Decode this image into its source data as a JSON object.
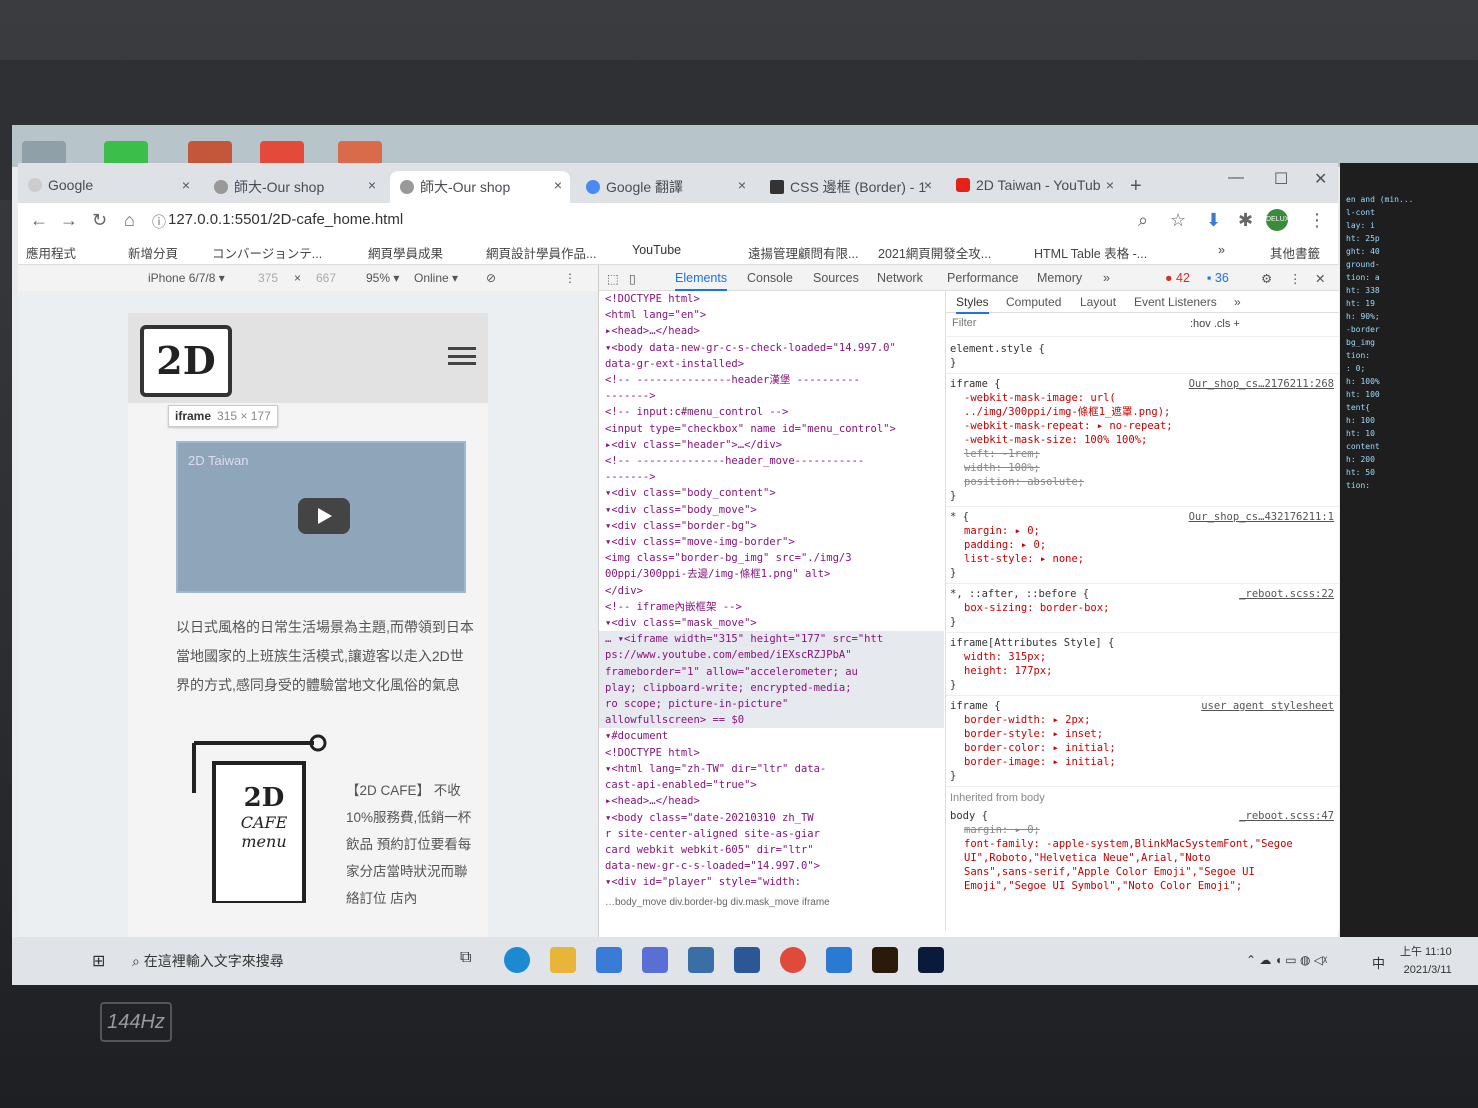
{
  "colors": {
    "accent": "#1a73e8",
    "youtube_red": "#e62117",
    "devtools_tag": "#881280",
    "selected_row": "#e6e9ee"
  },
  "browser": {
    "tabs": [
      {
        "label": "Google",
        "icon": "google-icon",
        "active": false
      },
      {
        "label": "師大-Our shop",
        "icon": "globe-icon",
        "active": false
      },
      {
        "label": "師大-Our shop",
        "icon": "globe-icon",
        "active": true
      },
      {
        "label": "Google 翻譯",
        "icon": "translate-icon",
        "active": false
      },
      {
        "label": "CSS 邊框 (Border) - 1",
        "icon": "site-icon",
        "active": false
      },
      {
        "label": "2D Taiwan - YouTub",
        "icon": "youtube-icon",
        "active": false
      }
    ],
    "new_tab": "+",
    "url": "127.0.0.1:5501/2D-cafe_home.html",
    "profile_badge": "DELUX",
    "bookmarks": [
      "應用程式",
      "新增分頁",
      "コンバージョンテ...",
      "網頁學員成果",
      "網頁設計學員作品...",
      "YouTube",
      "遠揚管理顧問有限...",
      "2021網頁開發全攻...",
      "HTML Table 表格 -...",
      "»",
      "其他書籤"
    ]
  },
  "device_toolbar": {
    "device": "iPhone 6/7/8 ▾",
    "width": "375",
    "times": "×",
    "height": "667",
    "zoom": "95% ▾",
    "network": "Online ▾"
  },
  "page": {
    "logo": "2D",
    "iframe_tip": {
      "tag": "iframe",
      "size": "315 × 177"
    },
    "video_channel": "2D Taiwan",
    "paragraph": "以日式風格的日常生活場景為主題,而帶領到日本當地國家的上班族生活模式,讓遊客以走入2D世界的方式,感同身受的體驗當地文化風俗的氣息",
    "menu_sign": [
      "2D",
      "CAFE",
      "menu"
    ],
    "cafe_text": "【2D CAFE】 不收10%服務費,低銷一杯飲品 預約訂位要看每家分店當時狀況而聯絡訂位 店內"
  },
  "devtools": {
    "tabs": [
      "Elements",
      "Console",
      "Sources",
      "Network",
      "Performance",
      "Memory",
      "»"
    ],
    "errors": "42",
    "warnings": "36",
    "elements": [
      "<!DOCTYPE html>",
      "<html lang=\"en\">",
      "▸<head>…</head>",
      "▾<body data-new-gr-c-s-check-loaded=\"14.997.0\"",
      "data-gr-ext-installed>",
      "  <!-- ---------------header漢堡 ----------",
      "  ------->",
      "  <!-- input:c#menu_control -->",
      "  <input type=\"checkbox\" name id=\"menu_control\">",
      "  ▸<div class=\"header\">…</div>",
      "  <!-- --------------header_move-----------",
      "  ------->",
      "  ▾<div class=\"body_content\">",
      "    ▾<div class=\"body_move\">",
      "      ▾<div class=\"border-bg\">",
      "        ▾<div class=\"move-img-border\">",
      "          <img class=\"border-bg_img\" src=\"./img/3",
      "          00ppi/300ppi-去邊/img-條框1.png\" alt>",
      "        </div>",
      "        <!-- iframe內嵌框架 -->",
      "        ▾<div class=\"mask_move\">",
      "… ▾<iframe width=\"315\" height=\"177\" src=\"htt",
      "          ps://www.youtube.com/embed/iEXscRZJPbA\"",
      "          frameborder=\"1\" allow=\"accelerometer; au",
      "          play; clipboard-write; encrypted-media;",
      "          ro scope; picture-in-picture\"",
      "          allowfullscreen> == $0",
      "            ▾#document",
      "              <!DOCTYPE html>",
      "              ▾<html lang=\"zh-TW\" dir=\"ltr\" data-",
      "              cast-api-enabled=\"true\">",
      "                ▸<head>…</head>",
      "                ▾<body class=\"date-20210310 zh_TW",
      "                r  site-center-aligned site-as-giar",
      "                card webkit webkit-605\" dir=\"ltr\"",
      "                data-new-gr-c-s-loaded=\"14.997.0\">",
      "                  ▾<div id=\"player\" style=\"width:"
    ],
    "breadcrumb": "…body_move   div.border-bg   div.mask_move   iframe",
    "styles_tabs": [
      "Styles",
      "Computed",
      "Layout",
      "Event Listeners",
      "»"
    ],
    "filter_placeholder": "Filter",
    "filter_tools": ":hov  .cls  +",
    "rules": [
      {
        "selector": "element.style {",
        "source": "",
        "props": [],
        "close": "}"
      },
      {
        "selector": "iframe {",
        "source": "Our_shop_cs…2176211:268",
        "props": [
          {
            "text": "-webkit-mask-image: url(",
            "strike": false
          },
          {
            "text": "  ../img/300ppi/img-條框1_遮罩.png);",
            "strike": false
          },
          {
            "text": "-webkit-mask-repeat: ▸ no-repeat;",
            "strike": false
          },
          {
            "text": "-webkit-mask-size: 100% 100%;",
            "strike": false
          },
          {
            "text": "left: -1rem;",
            "strike": true
          },
          {
            "text": "width: 100%;",
            "strike": true
          },
          {
            "text": "position: absolute;",
            "strike": true
          }
        ],
        "close": "}"
      },
      {
        "selector": "* {",
        "source": "Our_shop_cs…432176211:1",
        "props": [
          {
            "text": "margin: ▸ 0;",
            "strike": false
          },
          {
            "text": "padding: ▸ 0;",
            "strike": false
          },
          {
            "text": "list-style: ▸ none;",
            "strike": false
          }
        ],
        "close": "}"
      },
      {
        "selector": "*, ::after, ::before {",
        "source": "_reboot.scss:22",
        "props": [
          {
            "text": "box-sizing: border-box;",
            "strike": false
          }
        ],
        "close": "}"
      },
      {
        "selector": "iframe[Attributes Style] {",
        "source": "",
        "props": [
          {
            "text": "width: 315px;",
            "strike": false
          },
          {
            "text": "height: 177px;",
            "strike": false
          }
        ],
        "close": "}"
      },
      {
        "selector": "iframe {",
        "source": "user agent stylesheet",
        "props": [
          {
            "text": "border-width: ▸ 2px;",
            "strike": false
          },
          {
            "text": "border-style: ▸ inset;",
            "strike": false
          },
          {
            "text": "border-color: ▸ initial;",
            "strike": false
          },
          {
            "text": "border-image: ▸ initial;",
            "strike": false
          }
        ],
        "close": "}"
      }
    ],
    "inherited_label": "Inherited from body",
    "body_rule": {
      "selector": "body {",
      "source": "_reboot.scss:47",
      "props": [
        "margin: ▸ 0;",
        "font-family: -apple-system,BlinkMacSystemFont,\"Segoe",
        "  UI\",Roboto,\"Helvetica Neue\",Arial,\"Noto",
        "  Sans\",sans-serif,\"Apple Color Emoji\",\"Segoe UI",
        "  Emoji\",\"Segoe UI Symbol\",\"Noto Color Emoji\";"
      ]
    }
  },
  "taskbar": {
    "search_placeholder": "在這裡輸入文字來搜尋",
    "time": "上午 11:10",
    "date": "2021/3/11",
    "ime": "中"
  },
  "laptop_badge": "144Hz"
}
